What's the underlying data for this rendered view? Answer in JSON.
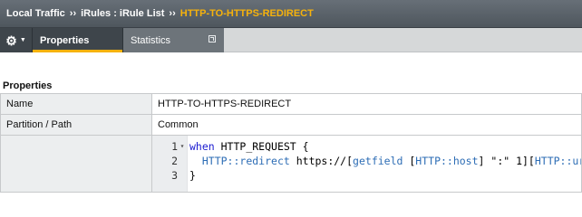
{
  "breadcrumb": {
    "items": [
      "Local Traffic",
      "iRules : iRule List"
    ],
    "separator": "››",
    "current": "HTTP-TO-HTTPS-REDIRECT"
  },
  "tabs": {
    "gear_icon": "gear-icon",
    "properties_label": "Properties",
    "statistics_label": "Statistics"
  },
  "section": {
    "title": "Properties"
  },
  "properties": {
    "name_label": "Name",
    "name_value": "HTTP-TO-HTTPS-REDIRECT",
    "partition_label": "Partition / Path",
    "partition_value": "Common"
  },
  "editor": {
    "lines": [
      {
        "num": "1",
        "fold": "▾",
        "parts": [
          [
            "kw",
            "when"
          ],
          [
            "plain",
            " HTTP_REQUEST {"
          ]
        ]
      },
      {
        "num": "2",
        "fold": "",
        "parts": [
          [
            "plain",
            "  "
          ],
          [
            "cmd",
            "HTTP::redirect"
          ],
          [
            "plain",
            " https://["
          ],
          [
            "cmd",
            "getfield"
          ],
          [
            "plain",
            " ["
          ],
          [
            "cmd",
            "HTTP::host"
          ],
          [
            "plain",
            "] \":\" 1]["
          ],
          [
            "cmd",
            "HTTP::uri"
          ],
          [
            "plain",
            "]"
          ]
        ]
      },
      {
        "num": "3",
        "fold": "",
        "parts": [
          [
            "plain",
            "}"
          ]
        ]
      }
    ]
  },
  "colors": {
    "accent": "#f6b20c",
    "topbar": "#5a6168",
    "tab_active": "#3e454b",
    "tab_inactive": "#6d747a"
  }
}
